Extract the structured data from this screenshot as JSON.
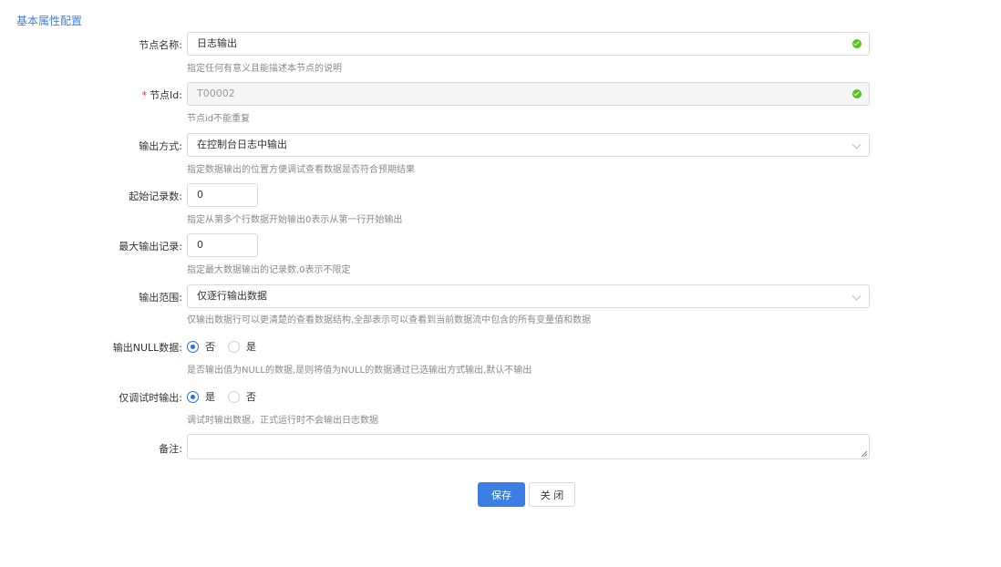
{
  "section_title": "基本属性配置",
  "fields": {
    "node_name": {
      "label": "节点名称:",
      "value": "日志输出",
      "hint": "指定任何有意义且能描述本节点的说明"
    },
    "node_id": {
      "required_mark": "*",
      "label": "节点Id:",
      "value": "T00002",
      "hint": "节点id不能重复"
    },
    "output_mode": {
      "label": "输出方式:",
      "value": "在控制台日志中输出",
      "hint": "指定数据输出的位置方便调试查看数据是否符合预期结果"
    },
    "start_record": {
      "label": "起始记录数:",
      "value": "0",
      "hint": "指定从第多个行数据开始输出0表示从第一行开始输出"
    },
    "max_output": {
      "label": "最大输出记录:",
      "value": "0",
      "hint": "指定最大数据输出的记录数,0表示不限定"
    },
    "output_scope": {
      "label": "输出范围:",
      "value": "仅逐行输出数据",
      "hint": "仅输出数据行可以更清楚的查看数据结构,全部表示可以查看到当前数据流中包含的所有变量值和数据"
    },
    "output_null": {
      "label": "输出NULL数据:",
      "options": [
        "否",
        "是"
      ],
      "selected": "否",
      "hint": "是否输出值为NULL的数据,是则将值为NULL的数据通过已选输出方式输出,默认不输出"
    },
    "debug_only": {
      "label": "仅调试时输出:",
      "options": [
        "是",
        "否"
      ],
      "selected": "是",
      "hint": "调试时输出数据，正式运行时不会输出日志数据"
    },
    "remark": {
      "label": "备注:",
      "value": ""
    }
  },
  "buttons": {
    "save": "保存",
    "close": "关 闭"
  },
  "colors": {
    "accent": "#3b7fe5",
    "success": "#52c41a",
    "required": "#f5222d"
  }
}
